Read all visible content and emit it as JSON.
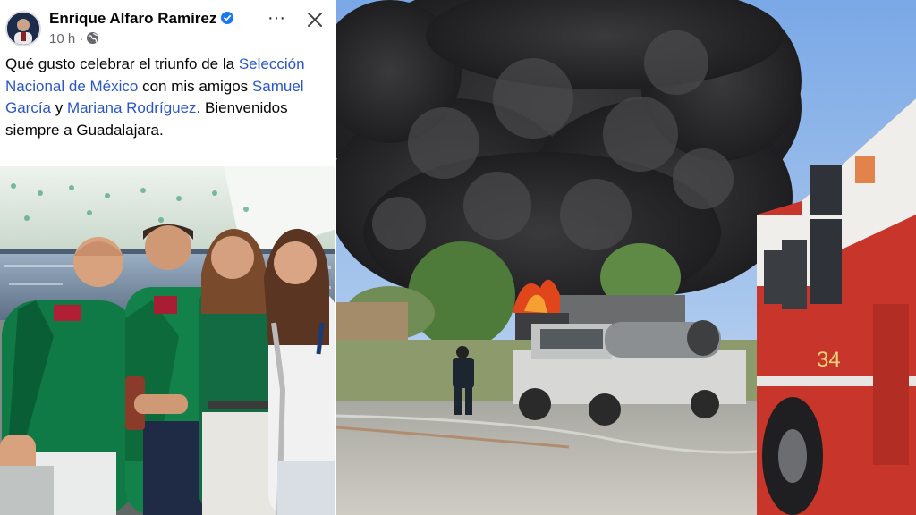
{
  "post": {
    "author": "Enrique Alfaro Ramírez",
    "time": "10 h ·",
    "more_label": "···",
    "text": {
      "t1": "Qué gusto celebrar el triunfo de la ",
      "link1": "Selección Nacional de México",
      "t2": " con mis amigos ",
      "link2": "Samuel García",
      "t3": " y ",
      "link3": "Mariana Rodríguez",
      "t4": ". Bienvenidos siempre a Guadalajara."
    }
  },
  "fire_photo": {
    "truck_number": "34"
  },
  "colors": {
    "link": "#2a56c6",
    "verified": "#1877f2",
    "jersey_green": "#0f7a45",
    "truck_red": "#c8352a"
  },
  "icons": [
    "verified-badge-icon",
    "globe-icon",
    "more-options-icon",
    "close-icon"
  ]
}
